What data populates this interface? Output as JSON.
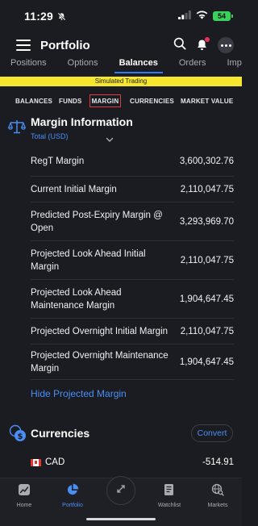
{
  "status_bar": {
    "time": "11:29",
    "battery": "54"
  },
  "header": {
    "title": "Portfolio"
  },
  "tabs": [
    {
      "label": "Positions",
      "active": false
    },
    {
      "label": "Options",
      "active": false
    },
    {
      "label": "Balances",
      "active": true
    },
    {
      "label": "Orders",
      "active": false
    },
    {
      "label": "Impact Lens",
      "active": false
    }
  ],
  "banner": "Simulated Trading",
  "subtabs": [
    "BALANCES",
    "FUNDS",
    "MARGIN",
    "CURRENCIES",
    "MARKET VALUE"
  ],
  "margin": {
    "title": "Margin Information",
    "subtitle": "Total (USD)",
    "rows": [
      {
        "label": "RegT Margin",
        "value": "3,600,302.76"
      },
      {
        "label": "Current Initial Margin",
        "value": "2,110,047.75"
      },
      {
        "label": "Predicted Post-Expiry Margin @ Open",
        "value": "3,293,969.70"
      },
      {
        "label": "Projected Look Ahead Initial Margin",
        "value": "2,110,047.75"
      },
      {
        "label": "Projected Look Ahead Maintenance Margin",
        "value": "1,904,647.45"
      },
      {
        "label": "Projected Overnight Initial Margin",
        "value": "2,110,047.75"
      },
      {
        "label": "Projected Overnight Maintenance Margin",
        "value": "1,904,647.45"
      }
    ],
    "hide_link": "Hide Projected Margin"
  },
  "currencies": {
    "title": "Currencies",
    "convert_label": "Convert",
    "items": [
      {
        "code": "CAD",
        "value": "-514.91"
      }
    ]
  },
  "bottom_nav": [
    {
      "label": "Home",
      "icon": "home-chart-icon"
    },
    {
      "label": "Portfolio",
      "icon": "pie-chart-icon"
    },
    {
      "label": "Watchlist",
      "icon": "watchlist-icon"
    },
    {
      "label": "Markets",
      "icon": "globe-search-icon"
    }
  ],
  "colors": {
    "accent": "#2e7df6",
    "link": "#4a8ef5",
    "banner": "#f6e62e",
    "highlight_border": "#e33a3a",
    "background": "#1b1c21"
  }
}
